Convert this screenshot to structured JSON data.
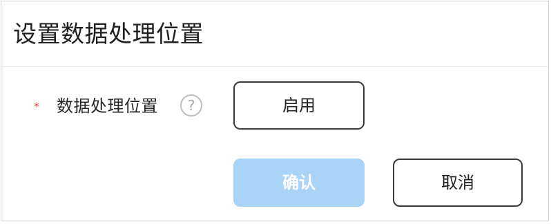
{
  "dialog": {
    "title": "设置数据处理位置",
    "field": {
      "required_mark": "*",
      "label": "数据处理位置",
      "help_glyph": "?",
      "button_label": "启用"
    },
    "actions": {
      "confirm_label": "确认",
      "confirm_disabled": true,
      "cancel_label": "取消"
    }
  },
  "icons": {
    "help": "question-circle-icon"
  },
  "colors": {
    "required": "#e74a4a",
    "confirm_disabled_bg": "#a9d4f8",
    "text": "#222222"
  }
}
